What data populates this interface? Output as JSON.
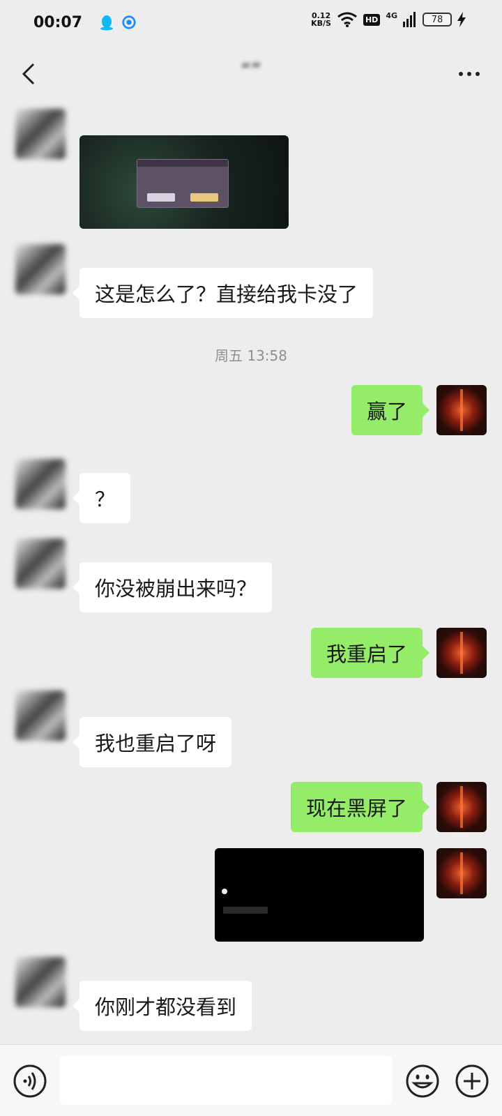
{
  "status_bar": {
    "time": "00:07",
    "net_speed_value": "0.12",
    "net_speed_unit": "KB/S",
    "hd": "HD",
    "network": "4G",
    "battery": "78"
  },
  "header": {
    "contact_name": "“”",
    "more_icon": "more-dots-icon",
    "back_icon": "back-chevron-icon"
  },
  "messages": [
    {
      "side": "left",
      "type": "image",
      "content_desc": "game-error-dialog-screenshot"
    },
    {
      "side": "left",
      "type": "text",
      "text": "这是怎么了？直接给我卡没了"
    },
    {
      "type": "time",
      "text": "周五 13:58"
    },
    {
      "side": "right",
      "type": "text",
      "text": "赢了"
    },
    {
      "side": "left",
      "type": "text",
      "text": "？"
    },
    {
      "side": "left",
      "type": "text",
      "text": "你没被崩出来吗？"
    },
    {
      "side": "right",
      "type": "text",
      "text": "我重启了"
    },
    {
      "side": "left",
      "type": "text",
      "text": "我也重启了呀"
    },
    {
      "side": "right",
      "type": "text",
      "text": "现在黑屏了"
    },
    {
      "side": "right",
      "type": "image",
      "content_desc": "black-screen-screenshot"
    },
    {
      "side": "left",
      "type": "text",
      "text": "你刚才都没看到"
    }
  ],
  "input_bar": {
    "voice_icon": "voice-icon",
    "emoji_icon": "emoji-icon",
    "plus_icon": "plus-icon",
    "placeholder": ""
  },
  "colors": {
    "background": "#ededed",
    "bubble_self": "#95ec69",
    "bubble_other": "#ffffff",
    "timestamp": "#8f8f8f"
  }
}
